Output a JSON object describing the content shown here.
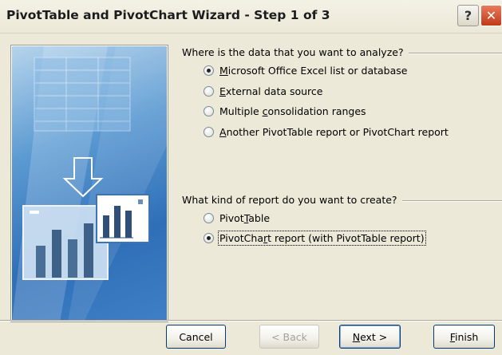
{
  "window": {
    "title": "PivotTable and PivotChart Wizard - Step 1 of 3",
    "help_label": "?",
    "close_label": "✕"
  },
  "source_group": {
    "question": "Where is the data that you want to analyze?",
    "options": [
      {
        "pre": "",
        "key": "M",
        "post": "icrosoft Office Excel list or database",
        "selected": true
      },
      {
        "pre": "",
        "key": "E",
        "post": "xternal data source",
        "selected": false
      },
      {
        "pre": "Multiple ",
        "key": "c",
        "post": "onsolidation ranges",
        "selected": false
      },
      {
        "pre": "",
        "key": "A",
        "post": "nother PivotTable report or PivotChart report",
        "selected": false
      }
    ]
  },
  "report_group": {
    "question": "What kind of report do you want to create?",
    "options": [
      {
        "pre": "Pivot",
        "key": "T",
        "post": "able",
        "selected": false
      },
      {
        "pre": "PivotCha",
        "key": "r",
        "post": "t report (with PivotTable report)",
        "selected": true
      }
    ]
  },
  "buttons": {
    "cancel": "Cancel",
    "back": "< Back",
    "next_pre": "",
    "next_key": "N",
    "next_post": "ext >",
    "finish_pre": "",
    "finish_key": "F",
    "finish_post": "inish"
  },
  "colors": {
    "dialog_bg": "#ece9d8",
    "art_blue": "#2f6fb8",
    "close_red": "#c13a18"
  }
}
